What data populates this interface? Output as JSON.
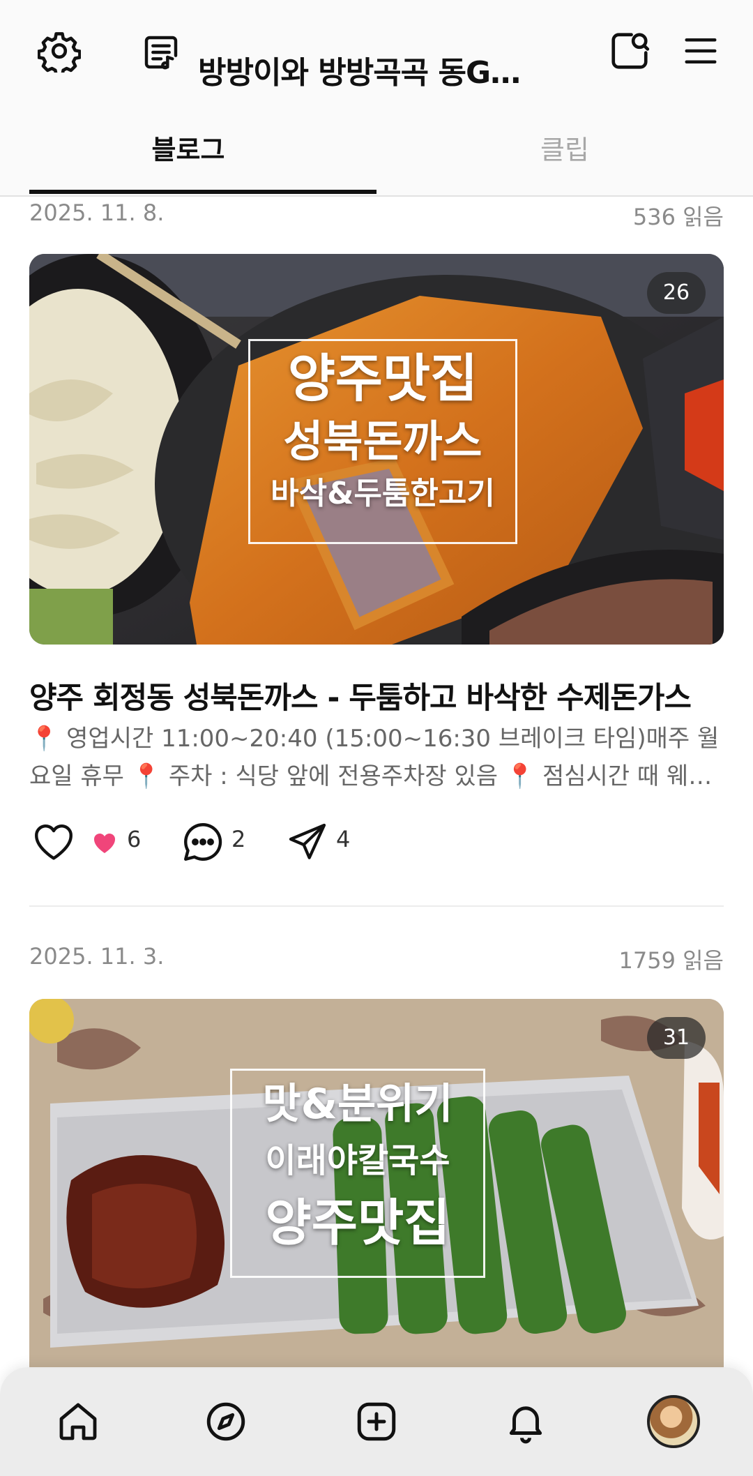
{
  "header": {
    "blog_title": "방방이와 방방곡곡 동GO...",
    "icons": [
      "gear-icon",
      "blog-list-icon",
      "search-icon",
      "menu-icon"
    ]
  },
  "tabs": [
    {
      "label": "블로그",
      "active": true
    },
    {
      "label": "클립",
      "active": false
    }
  ],
  "posts": [
    {
      "date": "2025. 11. 8.",
      "reads": "536 읽음",
      "photo_count": "26",
      "thumb_text": [
        "양주맛집",
        "성북돈까스",
        "바삭&두툼한고기"
      ],
      "title": "양주 회정동 성북돈까스 - 두툼하고 바삭한 수제돈가스",
      "snippet": "📍 영업시간 11:00~20:40 (15:00~16:30 브레이크 타임)매주 월요일 휴무 📍 주차 : 식당 앞에 전용주차장 있음 📍 점심시간 때 웨이팅이 있을 수 있음",
      "likes": "6",
      "comments": "2",
      "shares": "4"
    },
    {
      "date": "2025. 11. 3.",
      "reads": "1759 읽음",
      "photo_count": "31",
      "thumb_text": [
        "맛&분위기",
        "이래야칼국수",
        "양주맛집"
      ]
    }
  ],
  "bottom_nav": [
    "home-icon",
    "compass-icon",
    "add-post-icon",
    "bell-icon",
    "profile-avatar"
  ],
  "colors": {
    "accent_heart": "#f0457a",
    "text_primary": "#111111",
    "text_secondary": "#8a8a8a"
  }
}
